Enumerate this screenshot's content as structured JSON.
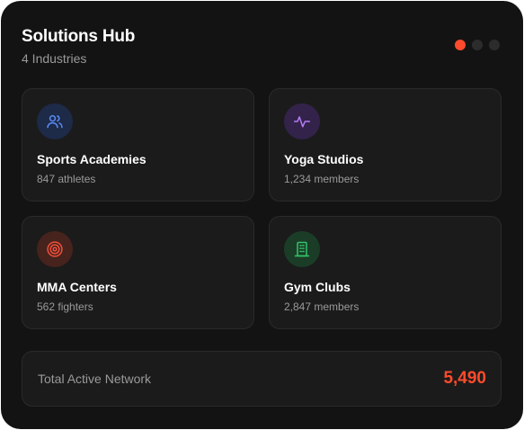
{
  "header": {
    "title": "Solutions Hub",
    "subtitle": "4 Industries"
  },
  "carousel": {
    "pages": 3,
    "active_index": 0
  },
  "industries": [
    {
      "name": "Sports Academies",
      "count": "847 athletes",
      "icon": "users-icon",
      "icon_color": "#5b8cf7",
      "icon_bg": "#1d2a48"
    },
    {
      "name": "Yoga Studios",
      "count": "1,234 members",
      "icon": "pulse-icon",
      "icon_color": "#b57cf6",
      "icon_bg": "#33234a"
    },
    {
      "name": "MMA Centers",
      "count": "562 fighters",
      "icon": "target-icon",
      "icon_color": "#f0503a",
      "icon_bg": "#47231d"
    },
    {
      "name": "Gym Clubs",
      "count": "2,847 members",
      "icon": "building-icon",
      "icon_color": "#33c46b",
      "icon_bg": "#1b3d27"
    }
  ],
  "footer": {
    "label": "Total Active Network",
    "value": "5,490",
    "value_color": "#ff4b2b"
  },
  "colors": {
    "accent": "#ff4b2b",
    "card_bg": "#131313",
    "tile_bg": "#1b1b1b"
  }
}
